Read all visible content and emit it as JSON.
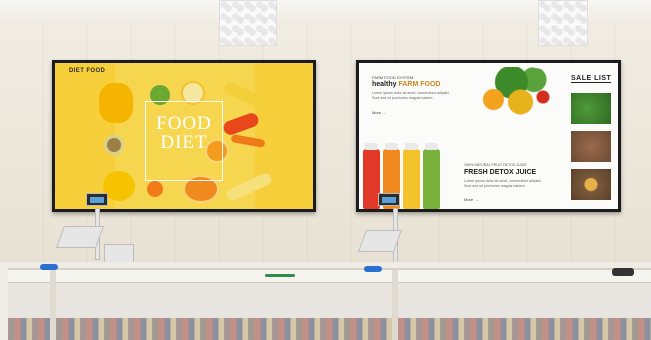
{
  "left_screen": {
    "brand": "DIET FOOD",
    "title_line1": "FOOD",
    "title_line2": "DIET",
    "subtitle": "",
    "colors": {
      "background": "#f7cf3b"
    }
  },
  "right_screen": {
    "system_label": "FARM FOOD SYSTEM",
    "headline_prefix": "healthy",
    "headline_highlight": "FARM FOOD",
    "body_text_1": "Lorem ipsum dolor sit amet, consectetur adipisci. Sunt sed sit pochurres magnis habere.",
    "more_1": "More  →",
    "juice_tag": "100% NATURAL FRUIT DETOX JUICE",
    "juice_headline": "FRESH DETOX JUICE",
    "body_text_2": "Lorem ipsum dolor sit amet, consectetur adipisci. Sunt sed sit pochurres magnis habere.",
    "more_2": "More  →",
    "sale_title": "SALE LIST",
    "colors": {
      "highlight": "#c8881f",
      "background": "#fbfbf9"
    }
  }
}
